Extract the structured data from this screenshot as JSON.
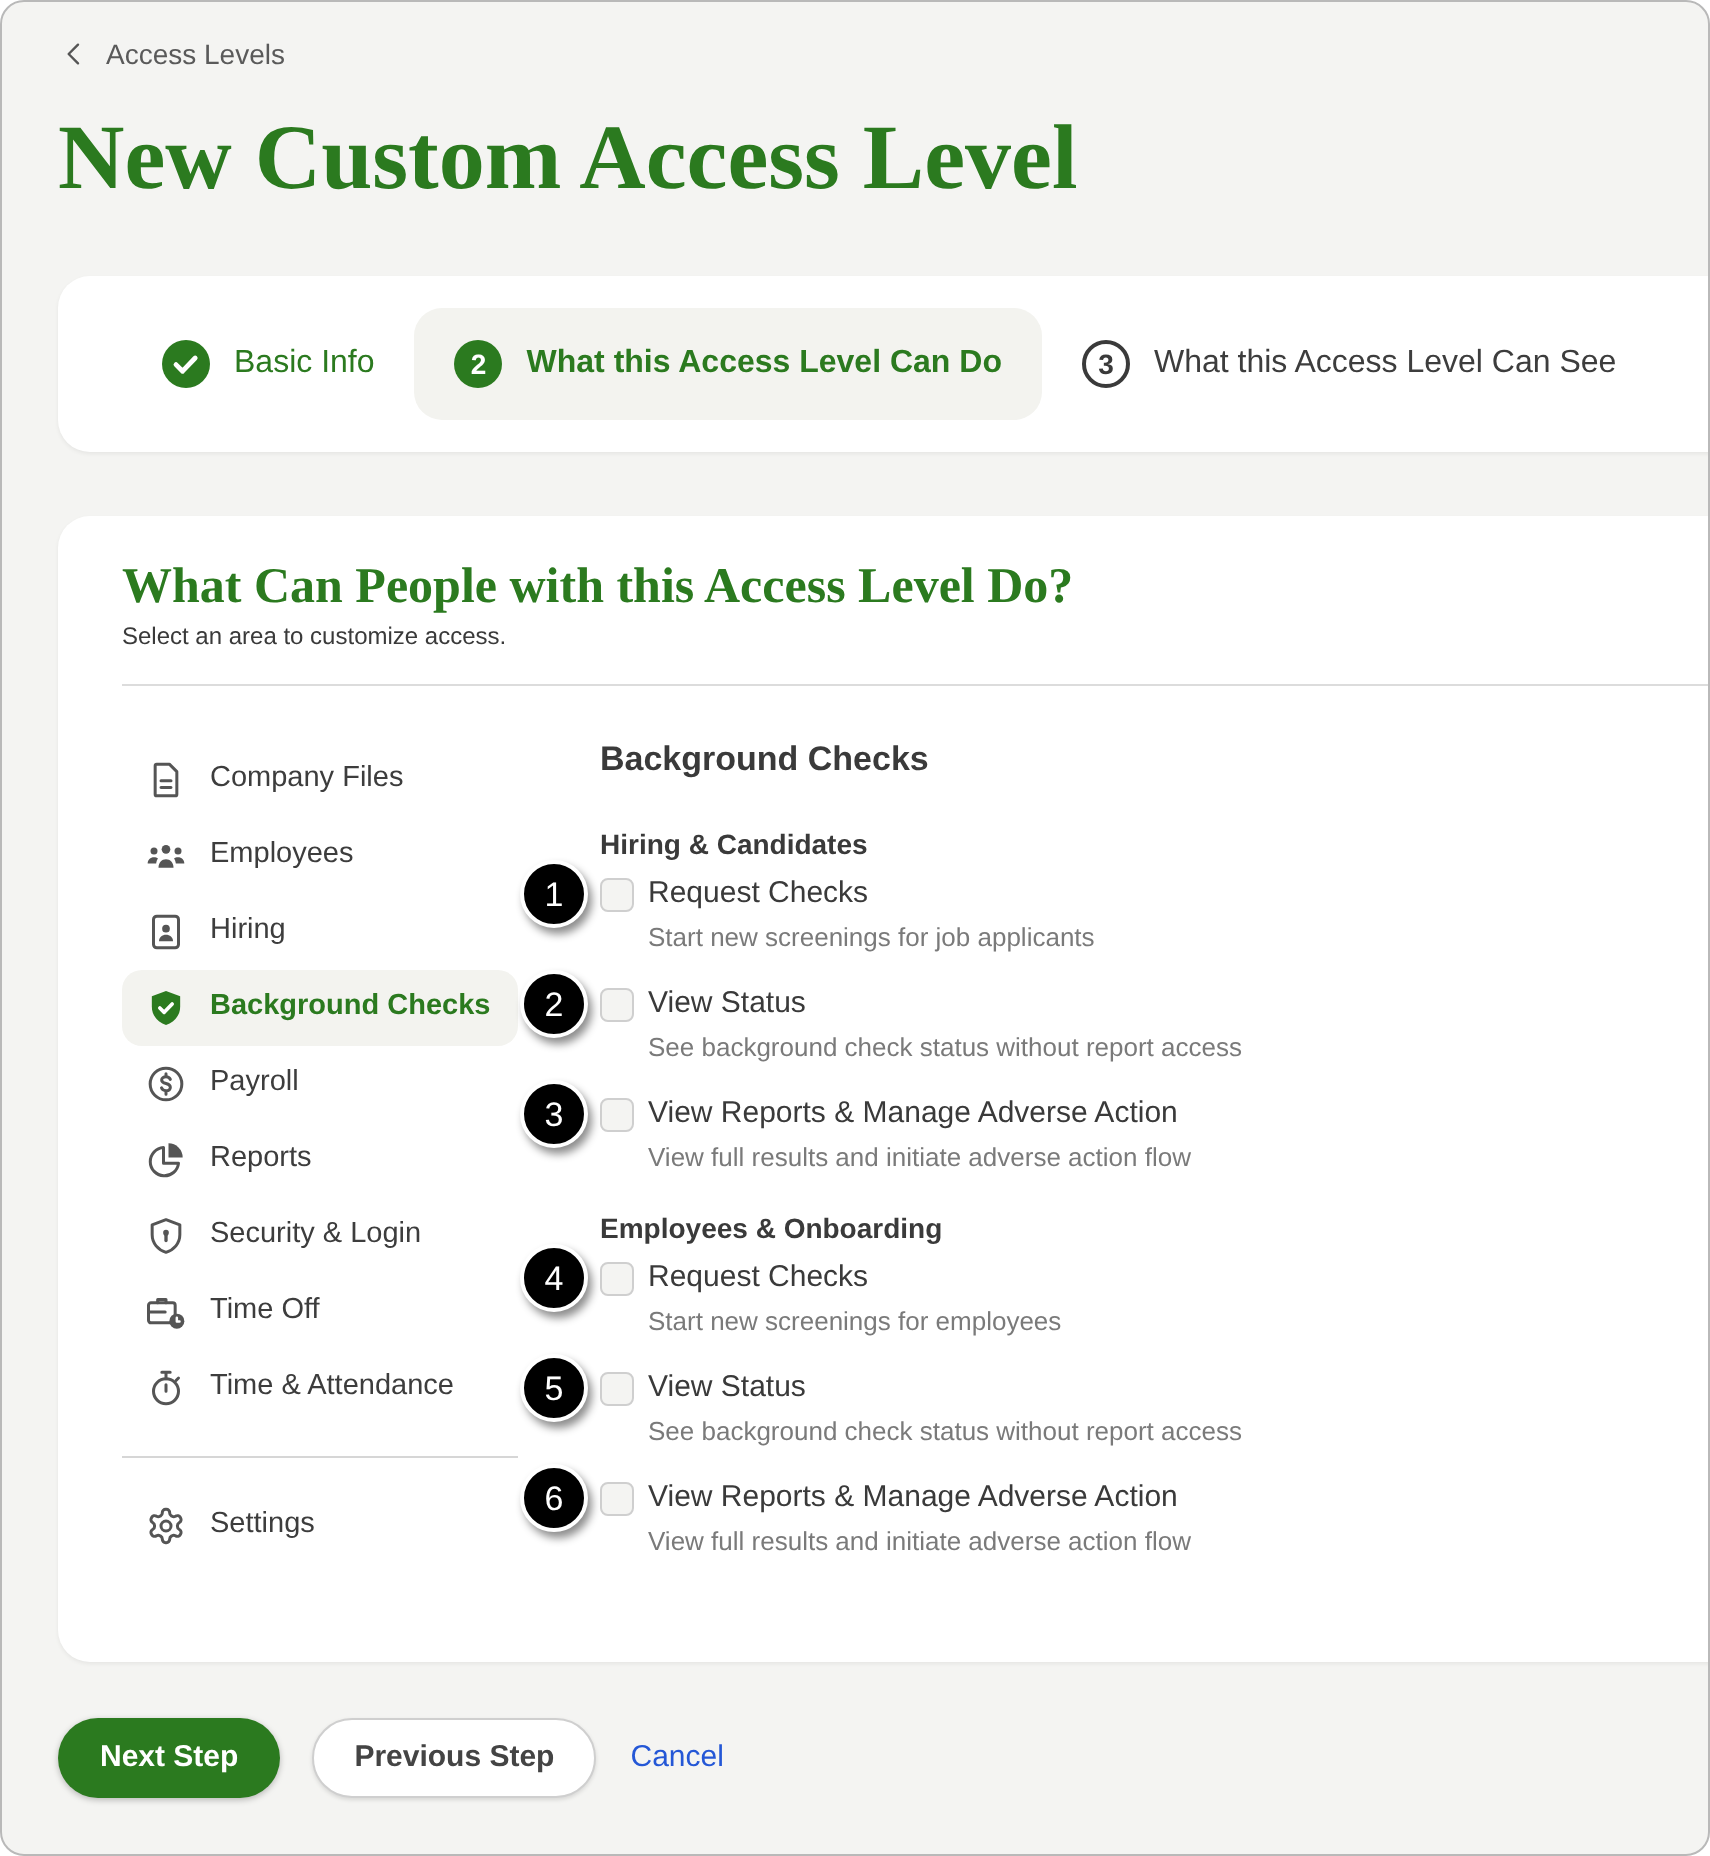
{
  "breadcrumb": {
    "label": "Access Levels"
  },
  "title": "New Custom Access Level",
  "steps": [
    {
      "label": "Basic Info",
      "completed": true,
      "selected": false
    },
    {
      "number": "2",
      "label": "What this Access Level Can Do",
      "completed": false,
      "selected": true
    },
    {
      "number": "3",
      "label": "What this Access Level Can See",
      "completed": false,
      "selected": false
    }
  ],
  "panel": {
    "title": "What Can People with this Access Level Do?",
    "subtitle": "Select an area to customize access."
  },
  "sidebar": {
    "items": [
      {
        "label": "Company Files",
        "selected": false
      },
      {
        "label": "Employees",
        "selected": false
      },
      {
        "label": "Hiring",
        "selected": false
      },
      {
        "label": "Background Checks",
        "selected": true
      },
      {
        "label": "Payroll",
        "selected": false
      },
      {
        "label": "Reports",
        "selected": false
      },
      {
        "label": "Security & Login",
        "selected": false
      },
      {
        "label": "Time Off",
        "selected": false
      },
      {
        "label": "Time & Attendance",
        "selected": false
      }
    ],
    "footer_items": [
      {
        "label": "Settings",
        "selected": false
      }
    ]
  },
  "section": {
    "title": "Background Checks",
    "groups": [
      {
        "title": "Hiring & Candidates",
        "permissions": [
          {
            "callout": "1",
            "label": "Request Checks",
            "description": "Start new screenings for job applicants",
            "checked": false
          },
          {
            "callout": "2",
            "label": "View Status",
            "description": "See background check status without report access",
            "checked": false
          },
          {
            "callout": "3",
            "label": "View Reports & Manage Adverse Action",
            "description": "View full results and initiate adverse action flow",
            "checked": false
          }
        ]
      },
      {
        "title": "Employees & Onboarding",
        "permissions": [
          {
            "callout": "4",
            "label": "Request Checks",
            "description": "Start new screenings for employees",
            "checked": false
          },
          {
            "callout": "5",
            "label": "View Status",
            "description": "See background check status without report access",
            "checked": false
          },
          {
            "callout": "6",
            "label": "View Reports & Manage Adverse Action",
            "description": "View full results and initiate adverse action flow",
            "checked": false
          }
        ]
      }
    ]
  },
  "actions": [
    {
      "label": "Next Step",
      "kind": "primary"
    },
    {
      "label": "Previous Step",
      "kind": "secondary"
    },
    {
      "label": "Cancel",
      "kind": "link"
    }
  ]
}
